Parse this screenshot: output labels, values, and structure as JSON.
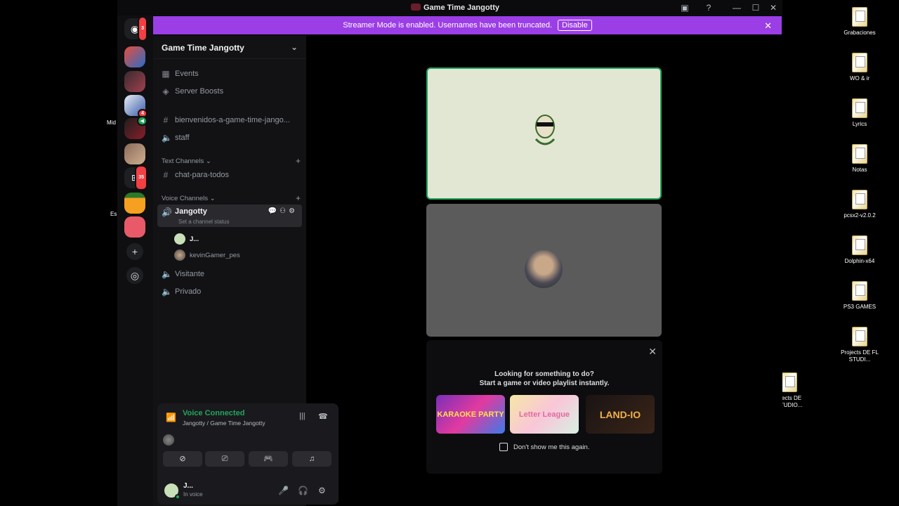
{
  "window": {
    "title": "Game Time Jangotty"
  },
  "streamer_banner": {
    "text": "Streamer Mode is enabled. Usernames have been truncated.",
    "button": "Disable"
  },
  "rail": {
    "home_badge": "3",
    "server_badge_1": "4",
    "server_badge_2": "35"
  },
  "sidebar": {
    "guild_name": "Game Time Jangotty",
    "events": "Events",
    "boosts": "Server Boosts",
    "channels_top": [
      {
        "name": "bienvenidos-a-game-time-jango..."
      },
      {
        "name": "staff"
      }
    ],
    "text_category": "Text Channels",
    "text_channels": [
      {
        "name": "chat-para-todos"
      }
    ],
    "voice_category": "Voice Channels",
    "active_voice": {
      "name": "Jangotty",
      "status": "Set a channel status"
    },
    "voice_users": [
      {
        "name": "J..."
      },
      {
        "name": "kevinGamer_pes"
      }
    ],
    "voice_channels": [
      {
        "name": "Visitante"
      },
      {
        "name": "Privado"
      }
    ]
  },
  "voice_panel": {
    "status": "Voice Connected",
    "location": "Jangotty / Game Time Jangotty"
  },
  "user_area": {
    "name": "J...",
    "status": "In voice"
  },
  "activity": {
    "line1": "Looking for something to do?",
    "line2": "Start a game or video playlist instantly.",
    "games": [
      {
        "title": "KARAOKE PARTY"
      },
      {
        "title": "Letter League"
      },
      {
        "title": "LAND-IO"
      }
    ],
    "dont_show": "Don't show me this again."
  },
  "desktop": {
    "icons": [
      {
        "label": "Grabaciones"
      },
      {
        "label": "WO & ir"
      },
      {
        "label": "Lyrics"
      },
      {
        "label": "Notas"
      },
      {
        "label": "pcsx2-v2.0.2"
      },
      {
        "label": "Dolphin-x64"
      },
      {
        "label": "PS3 GAMES"
      },
      {
        "label": "Projects DE FL STUDI..."
      },
      {
        "label": "ojects DE STUDIO..."
      }
    ],
    "left_label_1": "Mid",
    "left_label_2": "Es"
  }
}
